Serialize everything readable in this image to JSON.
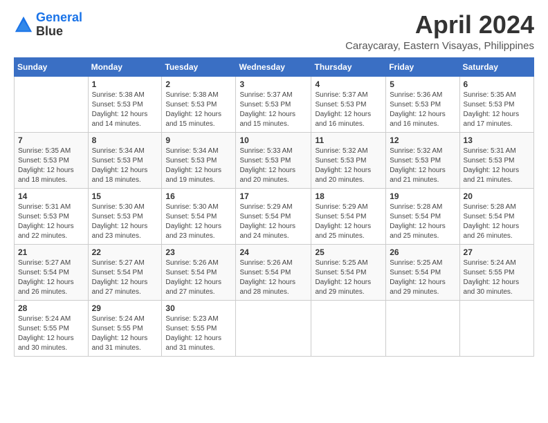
{
  "logo": {
    "line1": "General",
    "line2": "Blue"
  },
  "title": "April 2024",
  "subtitle": "Caraycaray, Eastern Visayas, Philippines",
  "weekdays": [
    "Sunday",
    "Monday",
    "Tuesday",
    "Wednesday",
    "Thursday",
    "Friday",
    "Saturday"
  ],
  "weeks": [
    [
      {
        "day": "",
        "sunrise": "",
        "sunset": "",
        "daylight": ""
      },
      {
        "day": "1",
        "sunrise": "Sunrise: 5:38 AM",
        "sunset": "Sunset: 5:53 PM",
        "daylight": "Daylight: 12 hours and 14 minutes."
      },
      {
        "day": "2",
        "sunrise": "Sunrise: 5:38 AM",
        "sunset": "Sunset: 5:53 PM",
        "daylight": "Daylight: 12 hours and 15 minutes."
      },
      {
        "day": "3",
        "sunrise": "Sunrise: 5:37 AM",
        "sunset": "Sunset: 5:53 PM",
        "daylight": "Daylight: 12 hours and 15 minutes."
      },
      {
        "day": "4",
        "sunrise": "Sunrise: 5:37 AM",
        "sunset": "Sunset: 5:53 PM",
        "daylight": "Daylight: 12 hours and 16 minutes."
      },
      {
        "day": "5",
        "sunrise": "Sunrise: 5:36 AM",
        "sunset": "Sunset: 5:53 PM",
        "daylight": "Daylight: 12 hours and 16 minutes."
      },
      {
        "day": "6",
        "sunrise": "Sunrise: 5:35 AM",
        "sunset": "Sunset: 5:53 PM",
        "daylight": "Daylight: 12 hours and 17 minutes."
      }
    ],
    [
      {
        "day": "7",
        "sunrise": "Sunrise: 5:35 AM",
        "sunset": "Sunset: 5:53 PM",
        "daylight": "Daylight: 12 hours and 18 minutes."
      },
      {
        "day": "8",
        "sunrise": "Sunrise: 5:34 AM",
        "sunset": "Sunset: 5:53 PM",
        "daylight": "Daylight: 12 hours and 18 minutes."
      },
      {
        "day": "9",
        "sunrise": "Sunrise: 5:34 AM",
        "sunset": "Sunset: 5:53 PM",
        "daylight": "Daylight: 12 hours and 19 minutes."
      },
      {
        "day": "10",
        "sunrise": "Sunrise: 5:33 AM",
        "sunset": "Sunset: 5:53 PM",
        "daylight": "Daylight: 12 hours and 20 minutes."
      },
      {
        "day": "11",
        "sunrise": "Sunrise: 5:32 AM",
        "sunset": "Sunset: 5:53 PM",
        "daylight": "Daylight: 12 hours and 20 minutes."
      },
      {
        "day": "12",
        "sunrise": "Sunrise: 5:32 AM",
        "sunset": "Sunset: 5:53 PM",
        "daylight": "Daylight: 12 hours and 21 minutes."
      },
      {
        "day": "13",
        "sunrise": "Sunrise: 5:31 AM",
        "sunset": "Sunset: 5:53 PM",
        "daylight": "Daylight: 12 hours and 21 minutes."
      }
    ],
    [
      {
        "day": "14",
        "sunrise": "Sunrise: 5:31 AM",
        "sunset": "Sunset: 5:53 PM",
        "daylight": "Daylight: 12 hours and 22 minutes."
      },
      {
        "day": "15",
        "sunrise": "Sunrise: 5:30 AM",
        "sunset": "Sunset: 5:53 PM",
        "daylight": "Daylight: 12 hours and 23 minutes."
      },
      {
        "day": "16",
        "sunrise": "Sunrise: 5:30 AM",
        "sunset": "Sunset: 5:54 PM",
        "daylight": "Daylight: 12 hours and 23 minutes."
      },
      {
        "day": "17",
        "sunrise": "Sunrise: 5:29 AM",
        "sunset": "Sunset: 5:54 PM",
        "daylight": "Daylight: 12 hours and 24 minutes."
      },
      {
        "day": "18",
        "sunrise": "Sunrise: 5:29 AM",
        "sunset": "Sunset: 5:54 PM",
        "daylight": "Daylight: 12 hours and 25 minutes."
      },
      {
        "day": "19",
        "sunrise": "Sunrise: 5:28 AM",
        "sunset": "Sunset: 5:54 PM",
        "daylight": "Daylight: 12 hours and 25 minutes."
      },
      {
        "day": "20",
        "sunrise": "Sunrise: 5:28 AM",
        "sunset": "Sunset: 5:54 PM",
        "daylight": "Daylight: 12 hours and 26 minutes."
      }
    ],
    [
      {
        "day": "21",
        "sunrise": "Sunrise: 5:27 AM",
        "sunset": "Sunset: 5:54 PM",
        "daylight": "Daylight: 12 hours and 26 minutes."
      },
      {
        "day": "22",
        "sunrise": "Sunrise: 5:27 AM",
        "sunset": "Sunset: 5:54 PM",
        "daylight": "Daylight: 12 hours and 27 minutes."
      },
      {
        "day": "23",
        "sunrise": "Sunrise: 5:26 AM",
        "sunset": "Sunset: 5:54 PM",
        "daylight": "Daylight: 12 hours and 27 minutes."
      },
      {
        "day": "24",
        "sunrise": "Sunrise: 5:26 AM",
        "sunset": "Sunset: 5:54 PM",
        "daylight": "Daylight: 12 hours and 28 minutes."
      },
      {
        "day": "25",
        "sunrise": "Sunrise: 5:25 AM",
        "sunset": "Sunset: 5:54 PM",
        "daylight": "Daylight: 12 hours and 29 minutes."
      },
      {
        "day": "26",
        "sunrise": "Sunrise: 5:25 AM",
        "sunset": "Sunset: 5:54 PM",
        "daylight": "Daylight: 12 hours and 29 minutes."
      },
      {
        "day": "27",
        "sunrise": "Sunrise: 5:24 AM",
        "sunset": "Sunset: 5:55 PM",
        "daylight": "Daylight: 12 hours and 30 minutes."
      }
    ],
    [
      {
        "day": "28",
        "sunrise": "Sunrise: 5:24 AM",
        "sunset": "Sunset: 5:55 PM",
        "daylight": "Daylight: 12 hours and 30 minutes."
      },
      {
        "day": "29",
        "sunrise": "Sunrise: 5:24 AM",
        "sunset": "Sunset: 5:55 PM",
        "daylight": "Daylight: 12 hours and 31 minutes."
      },
      {
        "day": "30",
        "sunrise": "Sunrise: 5:23 AM",
        "sunset": "Sunset: 5:55 PM",
        "daylight": "Daylight: 12 hours and 31 minutes."
      },
      {
        "day": "",
        "sunrise": "",
        "sunset": "",
        "daylight": ""
      },
      {
        "day": "",
        "sunrise": "",
        "sunset": "",
        "daylight": ""
      },
      {
        "day": "",
        "sunrise": "",
        "sunset": "",
        "daylight": ""
      },
      {
        "day": "",
        "sunrise": "",
        "sunset": "",
        "daylight": ""
      }
    ]
  ]
}
